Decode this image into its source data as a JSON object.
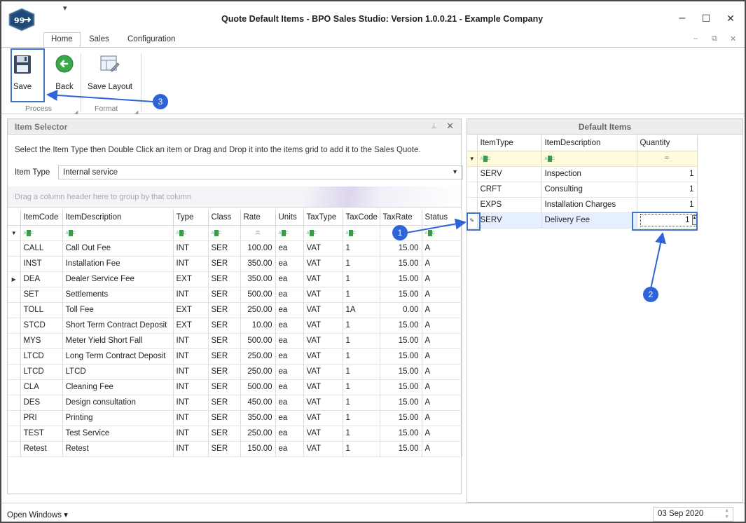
{
  "window": {
    "title": "Quote Default Items - BPO Sales Studio: Version 1.0.0.21 - Example Company",
    "qat_glyph": "▾",
    "minimize_glyph": "–",
    "maximize_glyph": "☐",
    "close_glyph": "✕"
  },
  "ribbon": {
    "tabs": [
      "Home",
      "Sales",
      "Configuration"
    ],
    "active_tab": "Home",
    "mdi_controls": [
      "–",
      "⧉",
      "✕"
    ],
    "buttons": {
      "save": "Save",
      "back": "Back",
      "save_layout": "Save Layout"
    },
    "groups": {
      "process": "Process",
      "format": "Format"
    }
  },
  "item_selector": {
    "title": "Item Selector",
    "instructions": "Select the Item Type then Double Click an item or Drag and Drop it into the items grid to add it to the Sales Quote.",
    "item_type_label": "Item Type",
    "item_type_value": "Internal service",
    "group_hint": "Drag a column header here to group by that column",
    "columns": [
      "ItemCode",
      "ItemDescription",
      "Type",
      "Class",
      "Rate",
      "Units",
      "TaxType",
      "TaxCode",
      "TaxRate",
      "Status"
    ],
    "filter_eq": "=",
    "rows": [
      [
        "CALL",
        "Call Out Fee",
        "INT",
        "SER",
        "100.00",
        "ea",
        "VAT",
        "1",
        "15.00",
        "A"
      ],
      [
        "INST",
        "Installation Fee",
        "INT",
        "SER",
        "350.00",
        "ea",
        "VAT",
        "1",
        "15.00",
        "A"
      ],
      [
        "DEA",
        "Dealer Service Fee",
        "EXT",
        "SER",
        "350.00",
        "ea",
        "VAT",
        "1",
        "15.00",
        "A"
      ],
      [
        "SET",
        "Settlements",
        "INT",
        "SER",
        "500.00",
        "ea",
        "VAT",
        "1",
        "15.00",
        "A"
      ],
      [
        "TOLL",
        "Toll Fee",
        "EXT",
        "SER",
        "250.00",
        "ea",
        "VAT",
        "1A",
        "0.00",
        "A"
      ],
      [
        "STCD",
        "Short Term Contract Deposit",
        "EXT",
        "SER",
        "10.00",
        "ea",
        "VAT",
        "1",
        "15.00",
        "A"
      ],
      [
        "MYS",
        "Meter Yield Short Fall",
        "INT",
        "SER",
        "500.00",
        "ea",
        "VAT",
        "1",
        "15.00",
        "A"
      ],
      [
        "LTCD",
        "Long Term Contract Deposit",
        "INT",
        "SER",
        "250.00",
        "ea",
        "VAT",
        "1",
        "15.00",
        "A"
      ],
      [
        "LTCD",
        "LTCD",
        "INT",
        "SER",
        "250.00",
        "ea",
        "VAT",
        "1",
        "15.00",
        "A"
      ],
      [
        "CLA",
        "Cleaning Fee",
        "INT",
        "SER",
        "500.00",
        "ea",
        "VAT",
        "1",
        "15.00",
        "A"
      ],
      [
        "DES",
        "Design consultation",
        "INT",
        "SER",
        "450.00",
        "ea",
        "VAT",
        "1",
        "15.00",
        "A"
      ],
      [
        "PRI",
        "Printing",
        "INT",
        "SER",
        "350.00",
        "ea",
        "VAT",
        "1",
        "15.00",
        "A"
      ],
      [
        "TEST",
        "Test Service",
        "INT",
        "SER",
        "250.00",
        "ea",
        "VAT",
        "1",
        "15.00",
        "A"
      ],
      [
        "Retest",
        "Retest",
        "INT",
        "SER",
        "150.00",
        "ea",
        "VAT",
        "1",
        "15.00",
        "A"
      ]
    ],
    "current_row_index": 2
  },
  "default_items": {
    "title": "Default Items",
    "columns": [
      "ItemType",
      "ItemDescription",
      "Quantity"
    ],
    "filter_eq": "=",
    "rows": [
      [
        "SERV",
        "Inspection",
        "1"
      ],
      [
        "CRFT",
        "Consulting",
        "1"
      ],
      [
        "EXPS",
        "Installation Charges",
        "1"
      ],
      [
        "SERV",
        "Delivery Fee",
        "1"
      ]
    ],
    "editing_row_index": 3
  },
  "status_bar": {
    "open_windows": "Open Windows ▾",
    "date": "03 Sep 2020"
  },
  "annotations": [
    "1",
    "2",
    "3"
  ],
  "colors": {
    "annotation": "#2f64d8",
    "filter_row": "#fffbdc",
    "selected_row": "#e6efff"
  }
}
